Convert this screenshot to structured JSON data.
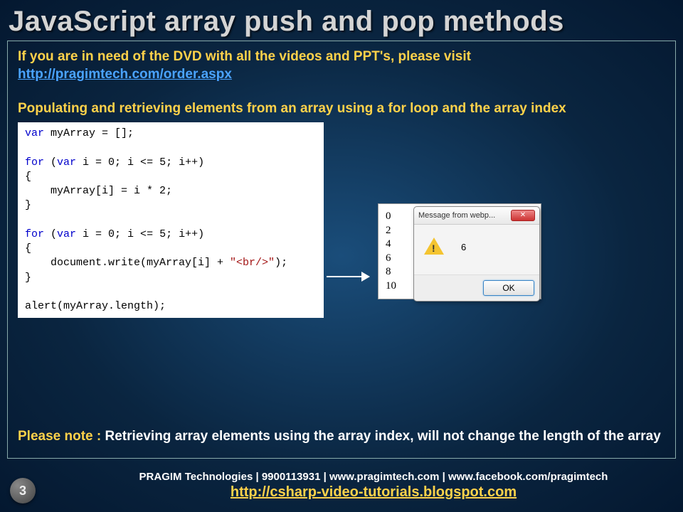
{
  "title": "JavaScript array push and pop methods",
  "intro": {
    "text": "If you are in need of the DVD with all the videos and PPT's, please visit",
    "link_text": "http://pragimtech.com/order.aspx",
    "link_href": "http://pragimtech.com/order.aspx"
  },
  "subheading": "Populating and retrieving elements from an array using a for loop and the array index",
  "code": {
    "lines": [
      {
        "t": "kw",
        "v": "var"
      },
      {
        "t": "p",
        "v": " myArray = [];"
      },
      {
        "t": "br"
      },
      {
        "t": "br"
      },
      {
        "t": "kw",
        "v": "for"
      },
      {
        "t": "p",
        "v": " ("
      },
      {
        "t": "kw",
        "v": "var"
      },
      {
        "t": "p",
        "v": " i = 0; i <= 5; i++)"
      },
      {
        "t": "br"
      },
      {
        "t": "p",
        "v": "{"
      },
      {
        "t": "br"
      },
      {
        "t": "p",
        "v": "    myArray[i] = i * 2;"
      },
      {
        "t": "br"
      },
      {
        "t": "p",
        "v": "}"
      },
      {
        "t": "br"
      },
      {
        "t": "br"
      },
      {
        "t": "kw",
        "v": "for"
      },
      {
        "t": "p",
        "v": " ("
      },
      {
        "t": "kw",
        "v": "var"
      },
      {
        "t": "p",
        "v": " i = 0; i <= 5; i++)"
      },
      {
        "t": "br"
      },
      {
        "t": "p",
        "v": "{"
      },
      {
        "t": "br"
      },
      {
        "t": "p",
        "v": "    document.write(myArray[i] + "
      },
      {
        "t": "str",
        "v": "\"<br/>\""
      },
      {
        "t": "p",
        "v": ");"
      },
      {
        "t": "br"
      },
      {
        "t": "p",
        "v": "}"
      },
      {
        "t": "br"
      },
      {
        "t": "br"
      },
      {
        "t": "p",
        "v": "alert(myArray.length);"
      }
    ]
  },
  "output_numbers": [
    "0",
    "2",
    "4",
    "6",
    "8",
    "10"
  ],
  "dialog": {
    "title": "Message from webp...",
    "message": "6",
    "ok": "OK",
    "close": "✕"
  },
  "note": {
    "prefix": "Please note : ",
    "body": "Retrieving array elements using the array index, will not change the length of the array"
  },
  "footer": {
    "page_number": "3",
    "line1": "PRAGIM Technologies | 9900113931 | www.pragimtech.com | www.facebook.com/pragimtech",
    "link_text": "http://csharp-video-tutorials.blogspot.com",
    "link_href": "http://csharp-video-tutorials.blogspot.com"
  }
}
